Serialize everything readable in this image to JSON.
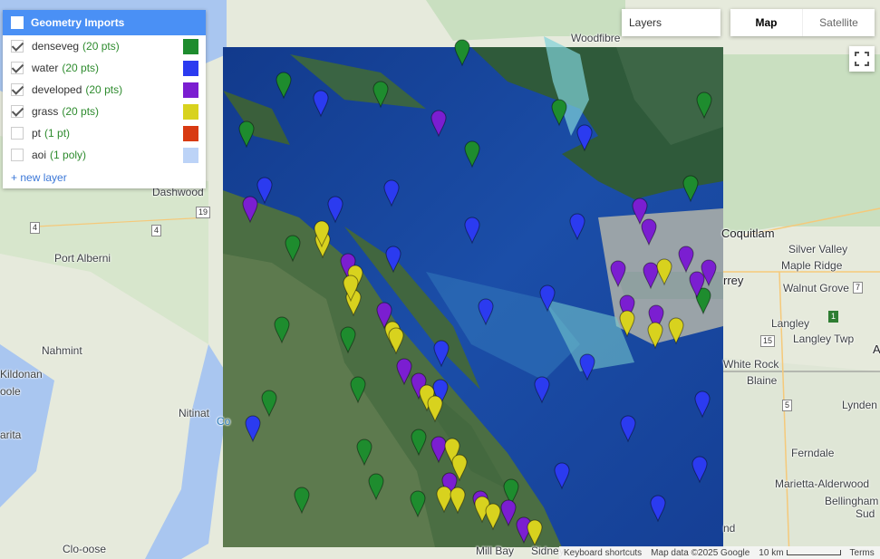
{
  "panel": {
    "title": "Geometry Imports",
    "layers": [
      {
        "name": "denseveg",
        "count": "(20 pts)",
        "checked": true,
        "color": "#1e8c2e"
      },
      {
        "name": "water",
        "count": "(20 pts)",
        "checked": true,
        "color": "#2b3bf0"
      },
      {
        "name": "developed",
        "count": "(20 pts)",
        "checked": true,
        "color": "#7b1ed1"
      },
      {
        "name": "grass",
        "count": "(20 pts)",
        "checked": true,
        "color": "#d8d21e"
      },
      {
        "name": "pt",
        "count": "(1 pt)",
        "checked": false,
        "color": "#d83a12"
      },
      {
        "name": "aoi",
        "count": "(1 poly)",
        "checked": false,
        "color": "#bcd3f7"
      }
    ],
    "new_layer": "+ new layer"
  },
  "controls": {
    "layers_label": "Layers",
    "map_label": "Map",
    "satellite_label": "Satellite",
    "fullscreen_icon": "fullscreen-icon"
  },
  "places": [
    {
      "name": "Woodfibre"
    },
    {
      "name": "Dashwood"
    },
    {
      "name": "Port Alberni"
    },
    {
      "name": "Nahmint"
    },
    {
      "name": "Kildonan"
    },
    {
      "name": "oole"
    },
    {
      "name": "Nitinat"
    },
    {
      "name": "arita"
    },
    {
      "name": "Clo-oose"
    },
    {
      "name": "Coquitlam"
    },
    {
      "name": "Silver Valley"
    },
    {
      "name": "Maple Ridge"
    },
    {
      "name": "Walnut Grove"
    },
    {
      "name": "rrey"
    },
    {
      "name": "Langley"
    },
    {
      "name": "Langley Twp"
    },
    {
      "name": "White Rock"
    },
    {
      "name": "Blaine"
    },
    {
      "name": "Lynden"
    },
    {
      "name": "Ferndale"
    },
    {
      "name": "Marietta-Alderwood"
    },
    {
      "name": "Bellingham"
    },
    {
      "name": "Sud"
    },
    {
      "name": "A"
    },
    {
      "name": "Mill Bay"
    },
    {
      "name": "Sidney"
    },
    {
      "name": "Co"
    },
    {
      "name": "nd"
    }
  ],
  "routes": [
    "19",
    "4",
    "4",
    "15",
    "5",
    "7",
    "1"
  ],
  "footer": {
    "shortcuts": "Keyboard shortcuts",
    "attribution": "Map data ©2025 Google",
    "scale": "10 km",
    "terms": "Terms"
  }
}
